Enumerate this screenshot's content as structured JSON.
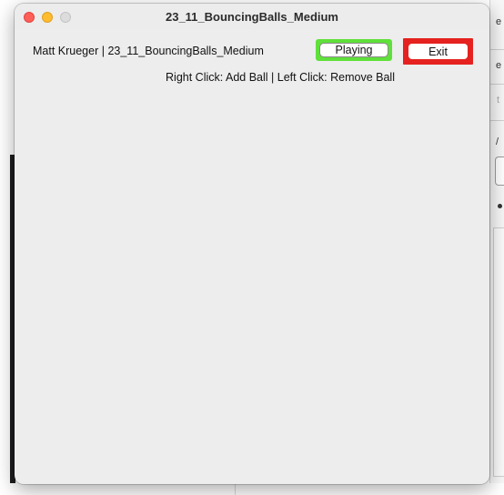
{
  "window": {
    "title": "23_11_BouncingBalls_Medium"
  },
  "header": {
    "label": "Matt Krueger | 23_11_BouncingBalls_Medium",
    "instructions": "Right Click: Add Ball | Left Click: Remove Ball"
  },
  "buttons": {
    "playing_label": "Playing",
    "exit_label": "Exit"
  },
  "colors": {
    "playing_highlight": "#5fe03a",
    "exit_highlight": "#e5221f",
    "window_background": "#ededed"
  },
  "background_fragments": {
    "frag_1": "e",
    "frag_2": "e",
    "frag_3": "t",
    "frag_4": "/"
  },
  "icons": [
    "close-icon",
    "minimize-icon",
    "zoom-icon"
  ]
}
